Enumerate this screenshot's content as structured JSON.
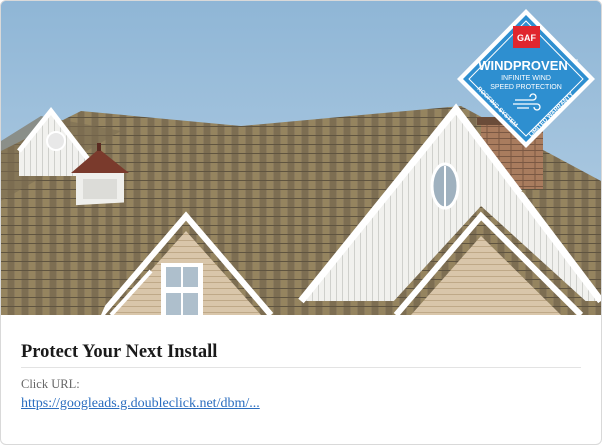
{
  "ad": {
    "badge": {
      "brand": "GAF",
      "headline": "WINDPROVEN",
      "trademark": "™",
      "subline_1": "INFINITE WIND",
      "subline_2": "SPEED PROTECTION",
      "arc_left": "ROOFING SYSTEM",
      "arc_right": "LIMITED WARRANTY"
    },
    "title": "Protect Your Next Install",
    "click_url_label": "Click URL:",
    "click_url": "https://googleads.g.doubleclick.net/dbm/..."
  },
  "colors": {
    "sky": "#9fc1dd",
    "shingle": "#8b7a5c",
    "trim": "#ffffff",
    "badge_blue": "#2e8fd0",
    "gaf_red": "#e0262e",
    "link": "#2a6dbf"
  }
}
